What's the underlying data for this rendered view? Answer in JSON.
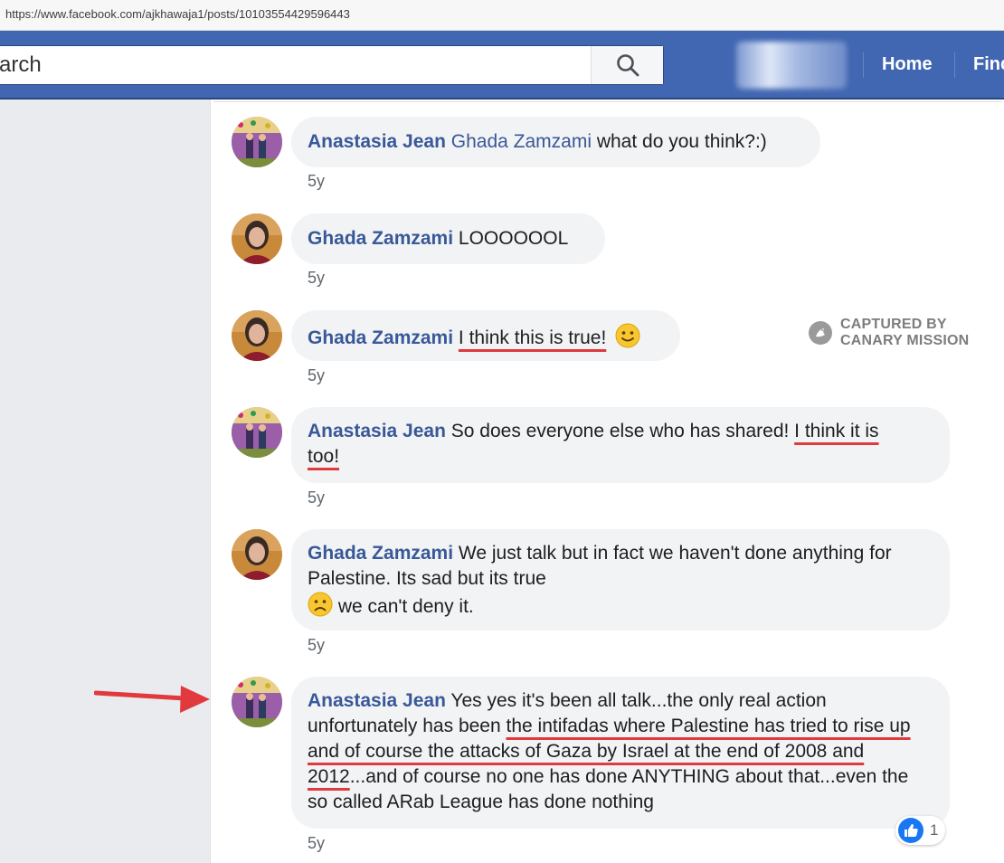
{
  "browser": {
    "url": "https://www.facebook.com/ajkhawaja1/posts/10103554429596443"
  },
  "header": {
    "search_placeholder": "arch",
    "nav": {
      "home": "Home",
      "find": "Find"
    }
  },
  "watermark": {
    "line1": "CAPTURED BY",
    "line2": "CANARY MISSION"
  },
  "comments": [
    {
      "author": "Anastasia Jean",
      "mention": "Ghada Zamzami",
      "text": " what do you think?:)",
      "time": "5y"
    },
    {
      "author": "Ghada Zamzami",
      "text": " LOOOOOOL",
      "time": "5y"
    },
    {
      "author": "Ghada Zamzami",
      "highlight": "I think this is true!",
      "time": "5y"
    },
    {
      "author": "Anastasia Jean",
      "text": " So does everyone else who has shared! ",
      "highlight_a": "I think it is",
      "highlight_b": "too!",
      "time": "5y"
    },
    {
      "author": "Ghada Zamzami",
      "text": " We just talk but in fact we haven't done anything for Palestine. Its sad but its true",
      "text2": " we can't deny it.",
      "time": "5y"
    },
    {
      "author": "Anastasia Jean",
      "text": " Yes yes it's been all talk...the only real action unfortunately has been ",
      "highlight": "the intifadas where Palestine has tried to rise up and of course the attacks of Gaza by Israel at the end of 2008 and 2012",
      "text2": "...and of course no one has done ANYTHING about that...even the so called ARab League has done nothing",
      "time": "5y",
      "like_count": "1"
    }
  ],
  "colors": {
    "fb_blue": "#4267b2",
    "author_link": "#385898",
    "bubble_bg": "#f2f3f5",
    "underline_red": "#e0393e"
  }
}
